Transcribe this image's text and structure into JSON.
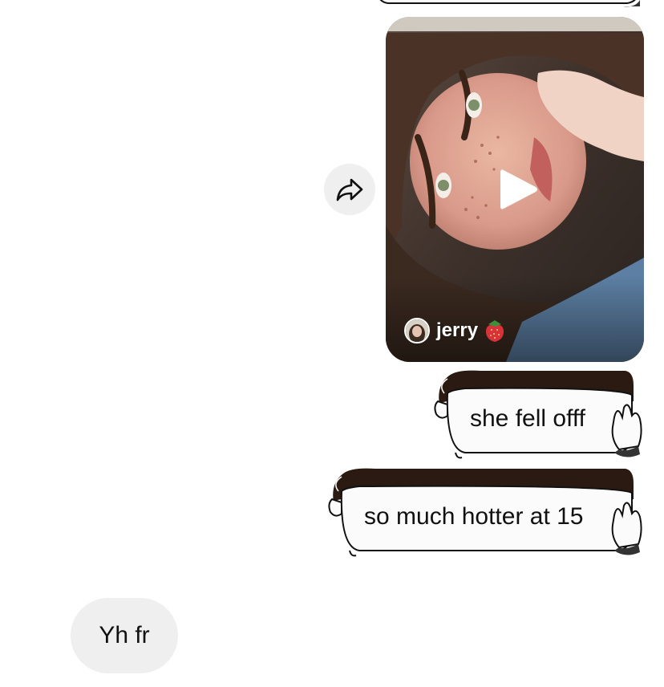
{
  "video_message": {
    "author_name": "jerry",
    "author_emoji_icon": "strawberry-icon",
    "play_icon": "play-icon"
  },
  "share": {
    "icon": "share-arrow-icon"
  },
  "sent_messages": [
    {
      "text": "she fell offf"
    },
    {
      "text": "so much hotter at 15"
    }
  ],
  "received_messages": [
    {
      "text": "Yh fr"
    }
  ],
  "colors": {
    "received_bubble": "#efefef",
    "sent_bubble_fill": "#fbfbfb",
    "bubble_hair": "#2b1a12",
    "text": "#111111"
  }
}
